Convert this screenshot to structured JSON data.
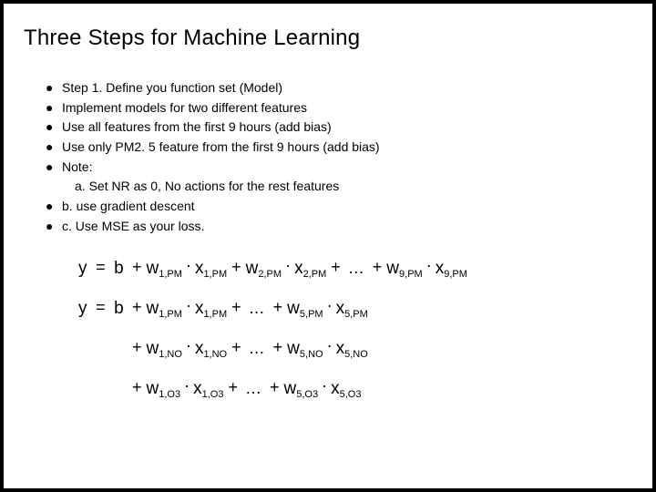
{
  "title": "Three Steps for Machine Learning",
  "bullets": {
    "items": [
      {
        "dot": "●",
        "text": "Step 1. Define you function set (Model)"
      },
      {
        "dot": "●",
        "text": "Implement models for two different features"
      },
      {
        "dot": "●",
        "text": "Use all features from the first 9 hours (add bias)"
      },
      {
        "dot": "●",
        "text": "Use only PM2. 5 feature from the first 9 hours (add bias)"
      },
      {
        "dot": "●",
        "text": "Note:"
      },
      {
        "dot": "",
        "text": "a. Set NR as 0,   No actions for the rest features",
        "indent": true
      },
      {
        "dot": "●",
        "text": "b. use gradient descent"
      },
      {
        "dot": "●",
        "text": "c. Use MSE as your loss."
      }
    ]
  },
  "equations": {
    "row1": {
      "lead_y": "y",
      "eq": "=",
      "b": "b",
      "plus": "+",
      "dot": "·",
      "ell": "…",
      "w": "w",
      "x": "x",
      "s1": "1,PM",
      "s2": "2,PM",
      "s9": "9,PM"
    },
    "row2": {
      "lead_y": "y",
      "eq": "=",
      "b": "b",
      "plus": "+",
      "dot": "·",
      "ell": "…",
      "w": "w",
      "x": "x",
      "s1": "1,PM",
      "s5": "5,PM"
    },
    "row3": {
      "plus": "+",
      "dot": "·",
      "ell": "…",
      "w": "w",
      "x": "x",
      "s1": "1,NO",
      "s5": "5,NO"
    },
    "row4": {
      "plus": "+",
      "dot": "·",
      "ell": "…",
      "w": "w",
      "x": "x",
      "s1": "1,O3",
      "s5": "5,O3"
    }
  }
}
